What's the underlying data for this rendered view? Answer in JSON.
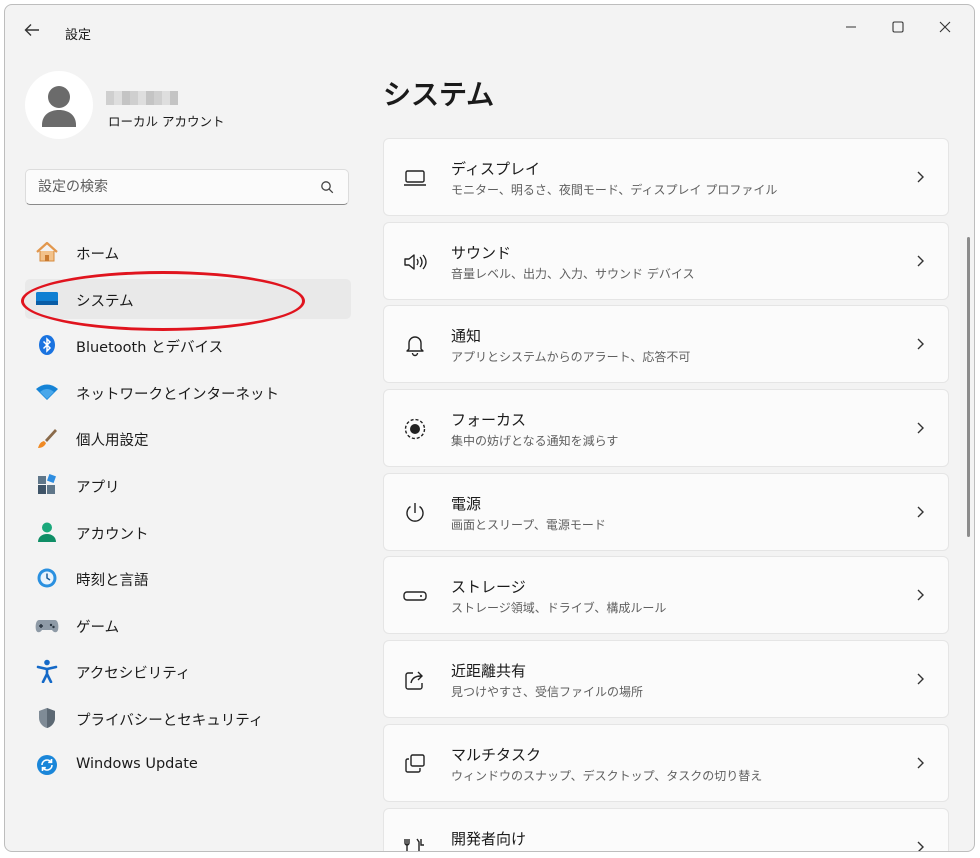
{
  "window": {
    "title": "設定"
  },
  "profile": {
    "account_type": "ローカル アカウント"
  },
  "search": {
    "placeholder": "設定の検索"
  },
  "nav": {
    "items": [
      {
        "label": "ホーム",
        "icon": "home-icon"
      },
      {
        "label": "システム",
        "icon": "system-icon",
        "selected": true
      },
      {
        "label": "Bluetooth とデバイス",
        "icon": "bluetooth-icon"
      },
      {
        "label": "ネットワークとインターネット",
        "icon": "wifi-icon"
      },
      {
        "label": "個人用設定",
        "icon": "brush-icon"
      },
      {
        "label": "アプリ",
        "icon": "apps-icon"
      },
      {
        "label": "アカウント",
        "icon": "account-icon"
      },
      {
        "label": "時刻と言語",
        "icon": "time-language-icon"
      },
      {
        "label": "ゲーム",
        "icon": "gamepad-icon"
      },
      {
        "label": "アクセシビリティ",
        "icon": "accessibility-icon"
      },
      {
        "label": "プライバシーとセキュリティ",
        "icon": "shield-icon"
      },
      {
        "label": "Windows Update",
        "icon": "windows-update-icon"
      }
    ]
  },
  "main": {
    "title": "システム",
    "cards": [
      {
        "title": "ディスプレイ",
        "subtitle": "モニター、明るさ、夜間モード、ディスプレイ プロファイル",
        "icon": "display-icon"
      },
      {
        "title": "サウンド",
        "subtitle": "音量レベル、出力、入力、サウンド デバイス",
        "icon": "speaker-icon"
      },
      {
        "title": "通知",
        "subtitle": "アプリとシステムからのアラート、応答不可",
        "icon": "bell-icon"
      },
      {
        "title": "フォーカス",
        "subtitle": "集中の妨げとなる通知を減らす",
        "icon": "focus-icon"
      },
      {
        "title": "電源",
        "subtitle": "画面とスリープ、電源モード",
        "icon": "power-icon"
      },
      {
        "title": "ストレージ",
        "subtitle": "ストレージ領域、ドライブ、構成ルール",
        "icon": "storage-icon"
      },
      {
        "title": "近距離共有",
        "subtitle": "見つけやすさ、受信ファイルの場所",
        "icon": "share-icon"
      },
      {
        "title": "マルチタスク",
        "subtitle": "ウィンドウのスナップ、デスクトップ、タスクの切り替え",
        "icon": "multitask-icon"
      },
      {
        "title": "開発者向け",
        "subtitle": "",
        "icon": "developer-icon"
      }
    ]
  },
  "colors": {
    "accent": "#0067c0",
    "highlight_ring": "#e0141e",
    "window_bg": "#f3f3f3",
    "card_bg": "#fbfbfb"
  }
}
